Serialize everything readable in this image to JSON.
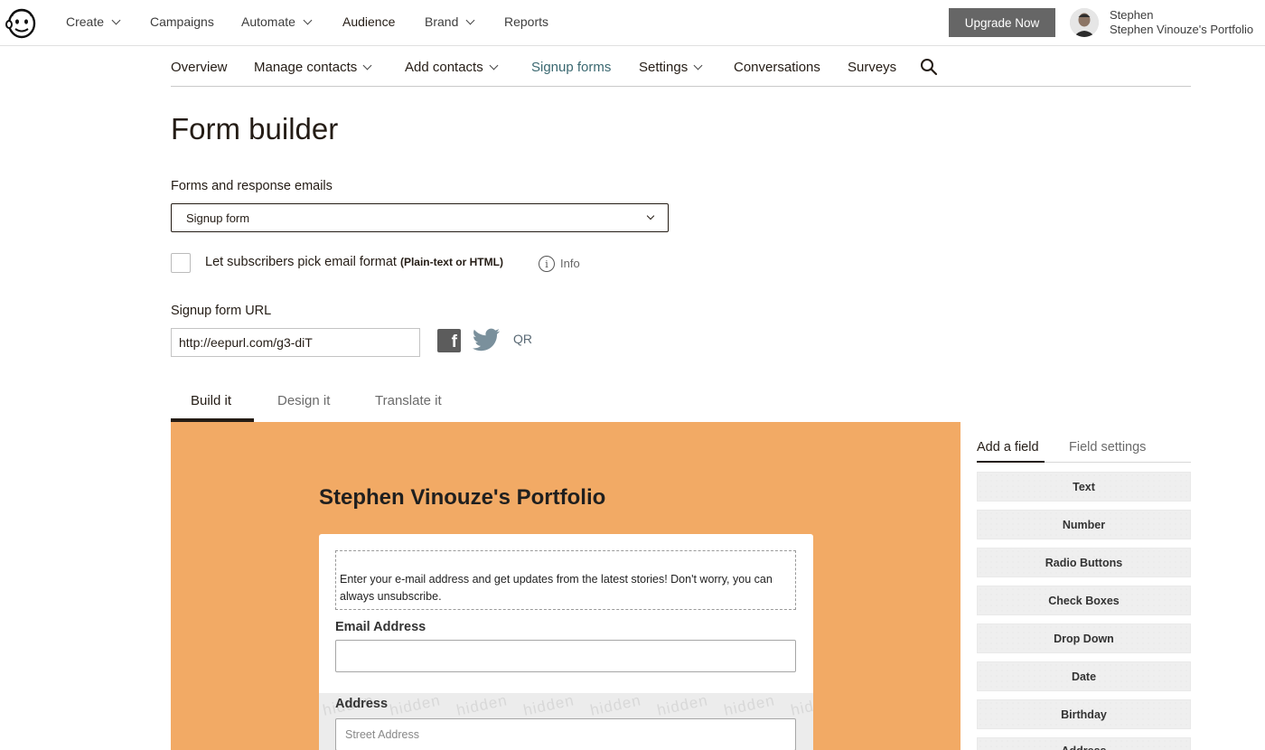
{
  "topnav": {
    "items": [
      {
        "label": "Create",
        "dropdown": true
      },
      {
        "label": "Campaigns",
        "dropdown": false
      },
      {
        "label": "Automate",
        "dropdown": true
      },
      {
        "label": "Audience",
        "dropdown": false,
        "active": true
      },
      {
        "label": "Brand",
        "dropdown": true
      },
      {
        "label": "Reports",
        "dropdown": false
      }
    ],
    "upgrade_label": "Upgrade Now",
    "user_name": "Stephen",
    "account_name": "Stephen Vinouze's Portfolio"
  },
  "subnav": {
    "items": [
      {
        "label": "Overview",
        "dropdown": false
      },
      {
        "label": "Manage contacts",
        "dropdown": true
      },
      {
        "label": "Add contacts",
        "dropdown": true
      },
      {
        "label": "Signup forms",
        "dropdown": false,
        "current": true
      },
      {
        "label": "Settings",
        "dropdown": true
      },
      {
        "label": "Conversations",
        "dropdown": false
      },
      {
        "label": "Surveys",
        "dropdown": false
      }
    ]
  },
  "page": {
    "title": "Form builder",
    "forms_label": "Forms and response emails",
    "forms_selected": "Signup form",
    "checkbox_label": "Let subscribers pick email format",
    "checkbox_sublabel": "(Plain-text or HTML)",
    "checkbox_checked": false,
    "info_icon_glyph": "i",
    "info_label": "Info",
    "url_label": "Signup form URL",
    "url_value": "http://eepurl.com/g3-diT",
    "facebook_glyph": "f",
    "qr_label": "QR"
  },
  "tabs": [
    {
      "label": "Build it",
      "active": true
    },
    {
      "label": "Design it",
      "active": false
    },
    {
      "label": "Translate it",
      "active": false
    }
  ],
  "form_preview": {
    "background_color": "#f2aa65",
    "heading": "Stephen Vinouze's Portfolio",
    "intro_text": "Enter your e-mail address and get updates from the latest stories! Don't worry, you can always unsubscribe.",
    "email_label": "Email Address",
    "address_label": "Address",
    "address_placeholder": "Street Address",
    "hidden_watermark": "hidden"
  },
  "right_panel": {
    "tabs": [
      {
        "label": "Add a field",
        "active": true
      },
      {
        "label": "Field settings",
        "active": false
      }
    ],
    "field_types": [
      "Text",
      "Number",
      "Radio Buttons",
      "Check Boxes",
      "Drop Down",
      "Date",
      "Birthday",
      "Address"
    ]
  }
}
